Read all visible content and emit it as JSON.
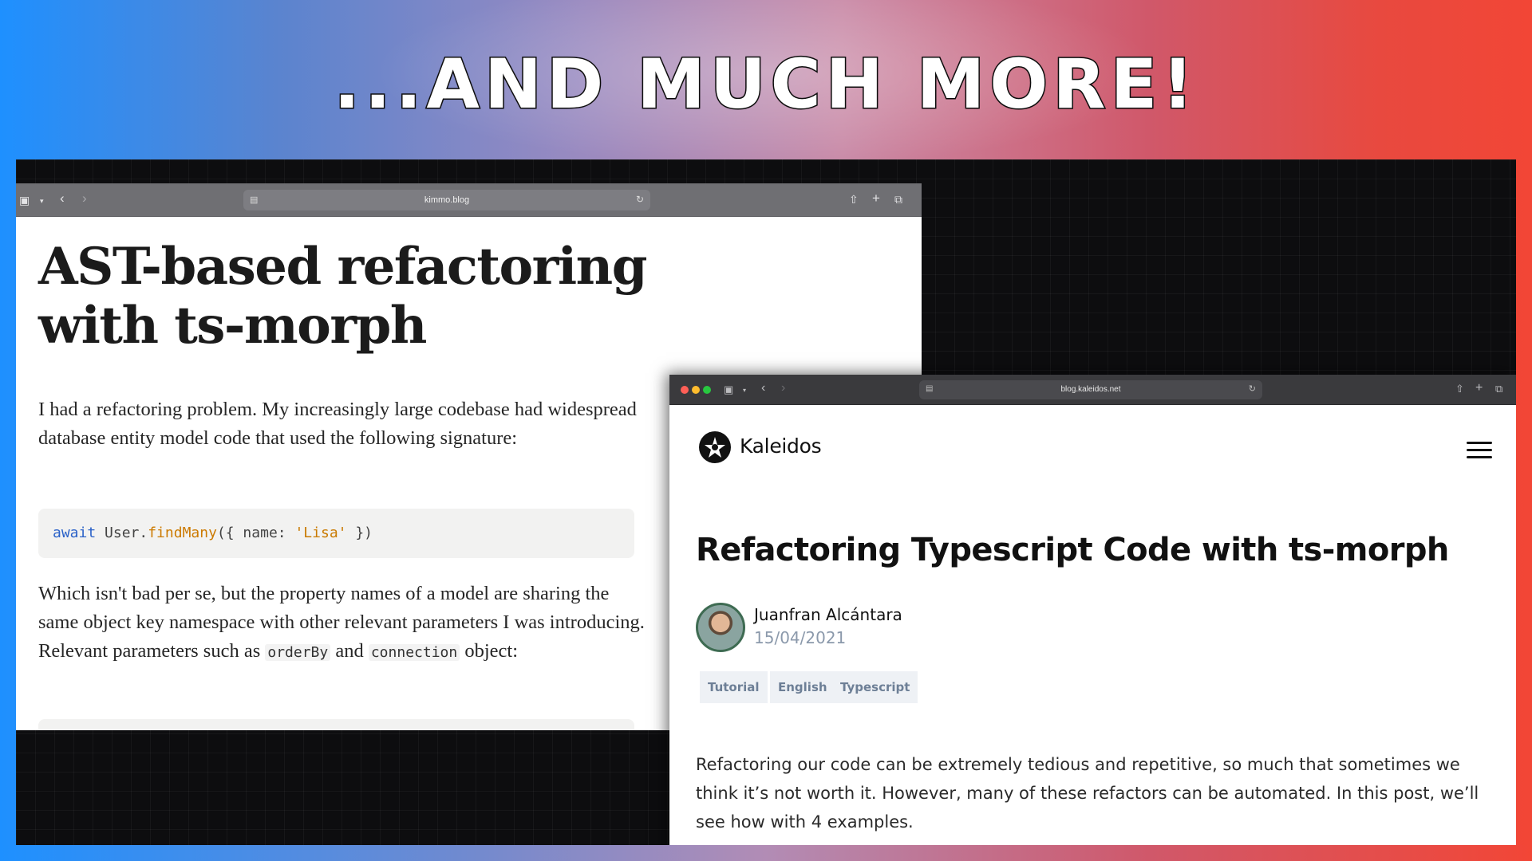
{
  "headline": "...AND MUCH MORE!",
  "window1": {
    "url": "kimmo.blog",
    "title": "AST-based refactoring with ts-morph",
    "para1": "I had a refactoring problem. My increasingly large codebase had widespread database entity model code that used the following signature:",
    "code": {
      "kw": "await",
      "obj": " User.",
      "fn": "findMany",
      "open": "({ name: ",
      "str": "'Lisa'",
      "close": " })"
    },
    "para2_start": "Which isn't bad per se, but the property names of a model are sharing the same object key namespace with other relevant parameters I was introducing. Relevant parameters such as ",
    "code_orderby": "orderBy",
    "para2_and": " and ",
    "code_connection": "connection",
    "para2_end": " object:"
  },
  "window2": {
    "url": "blog.kaleidos.net",
    "brand": "Kaleidos",
    "title": "Refactoring Typescript Code with ts-morph",
    "author": "Juanfran Alcántara",
    "date": "15/04/2021",
    "tags": [
      "Tutorial",
      "English",
      "Typescript"
    ],
    "body": "Refactoring our code can be extremely tedious and repetitive, so much that sometimes we think it’s not worth it. However, many of these refactors can be automated. In this post, we’ll see how with 4 examples."
  },
  "icons": [
    "sidebar-icon",
    "chevron-down-icon",
    "back-icon",
    "forward-icon",
    "page-icon",
    "reload-icon",
    "share-icon",
    "new-tab-icon",
    "tabs-icon",
    "kaleidos-logo-icon",
    "menu-icon"
  ],
  "colors": {
    "traffic_red": "#ff5f57",
    "traffic_yellow": "#febc2e",
    "traffic_green": "#28c840",
    "code_keyword": "#2b62c8",
    "code_function": "#cc7a00",
    "tag_text": "#6d7f96",
    "date_text": "#8b99ab"
  }
}
